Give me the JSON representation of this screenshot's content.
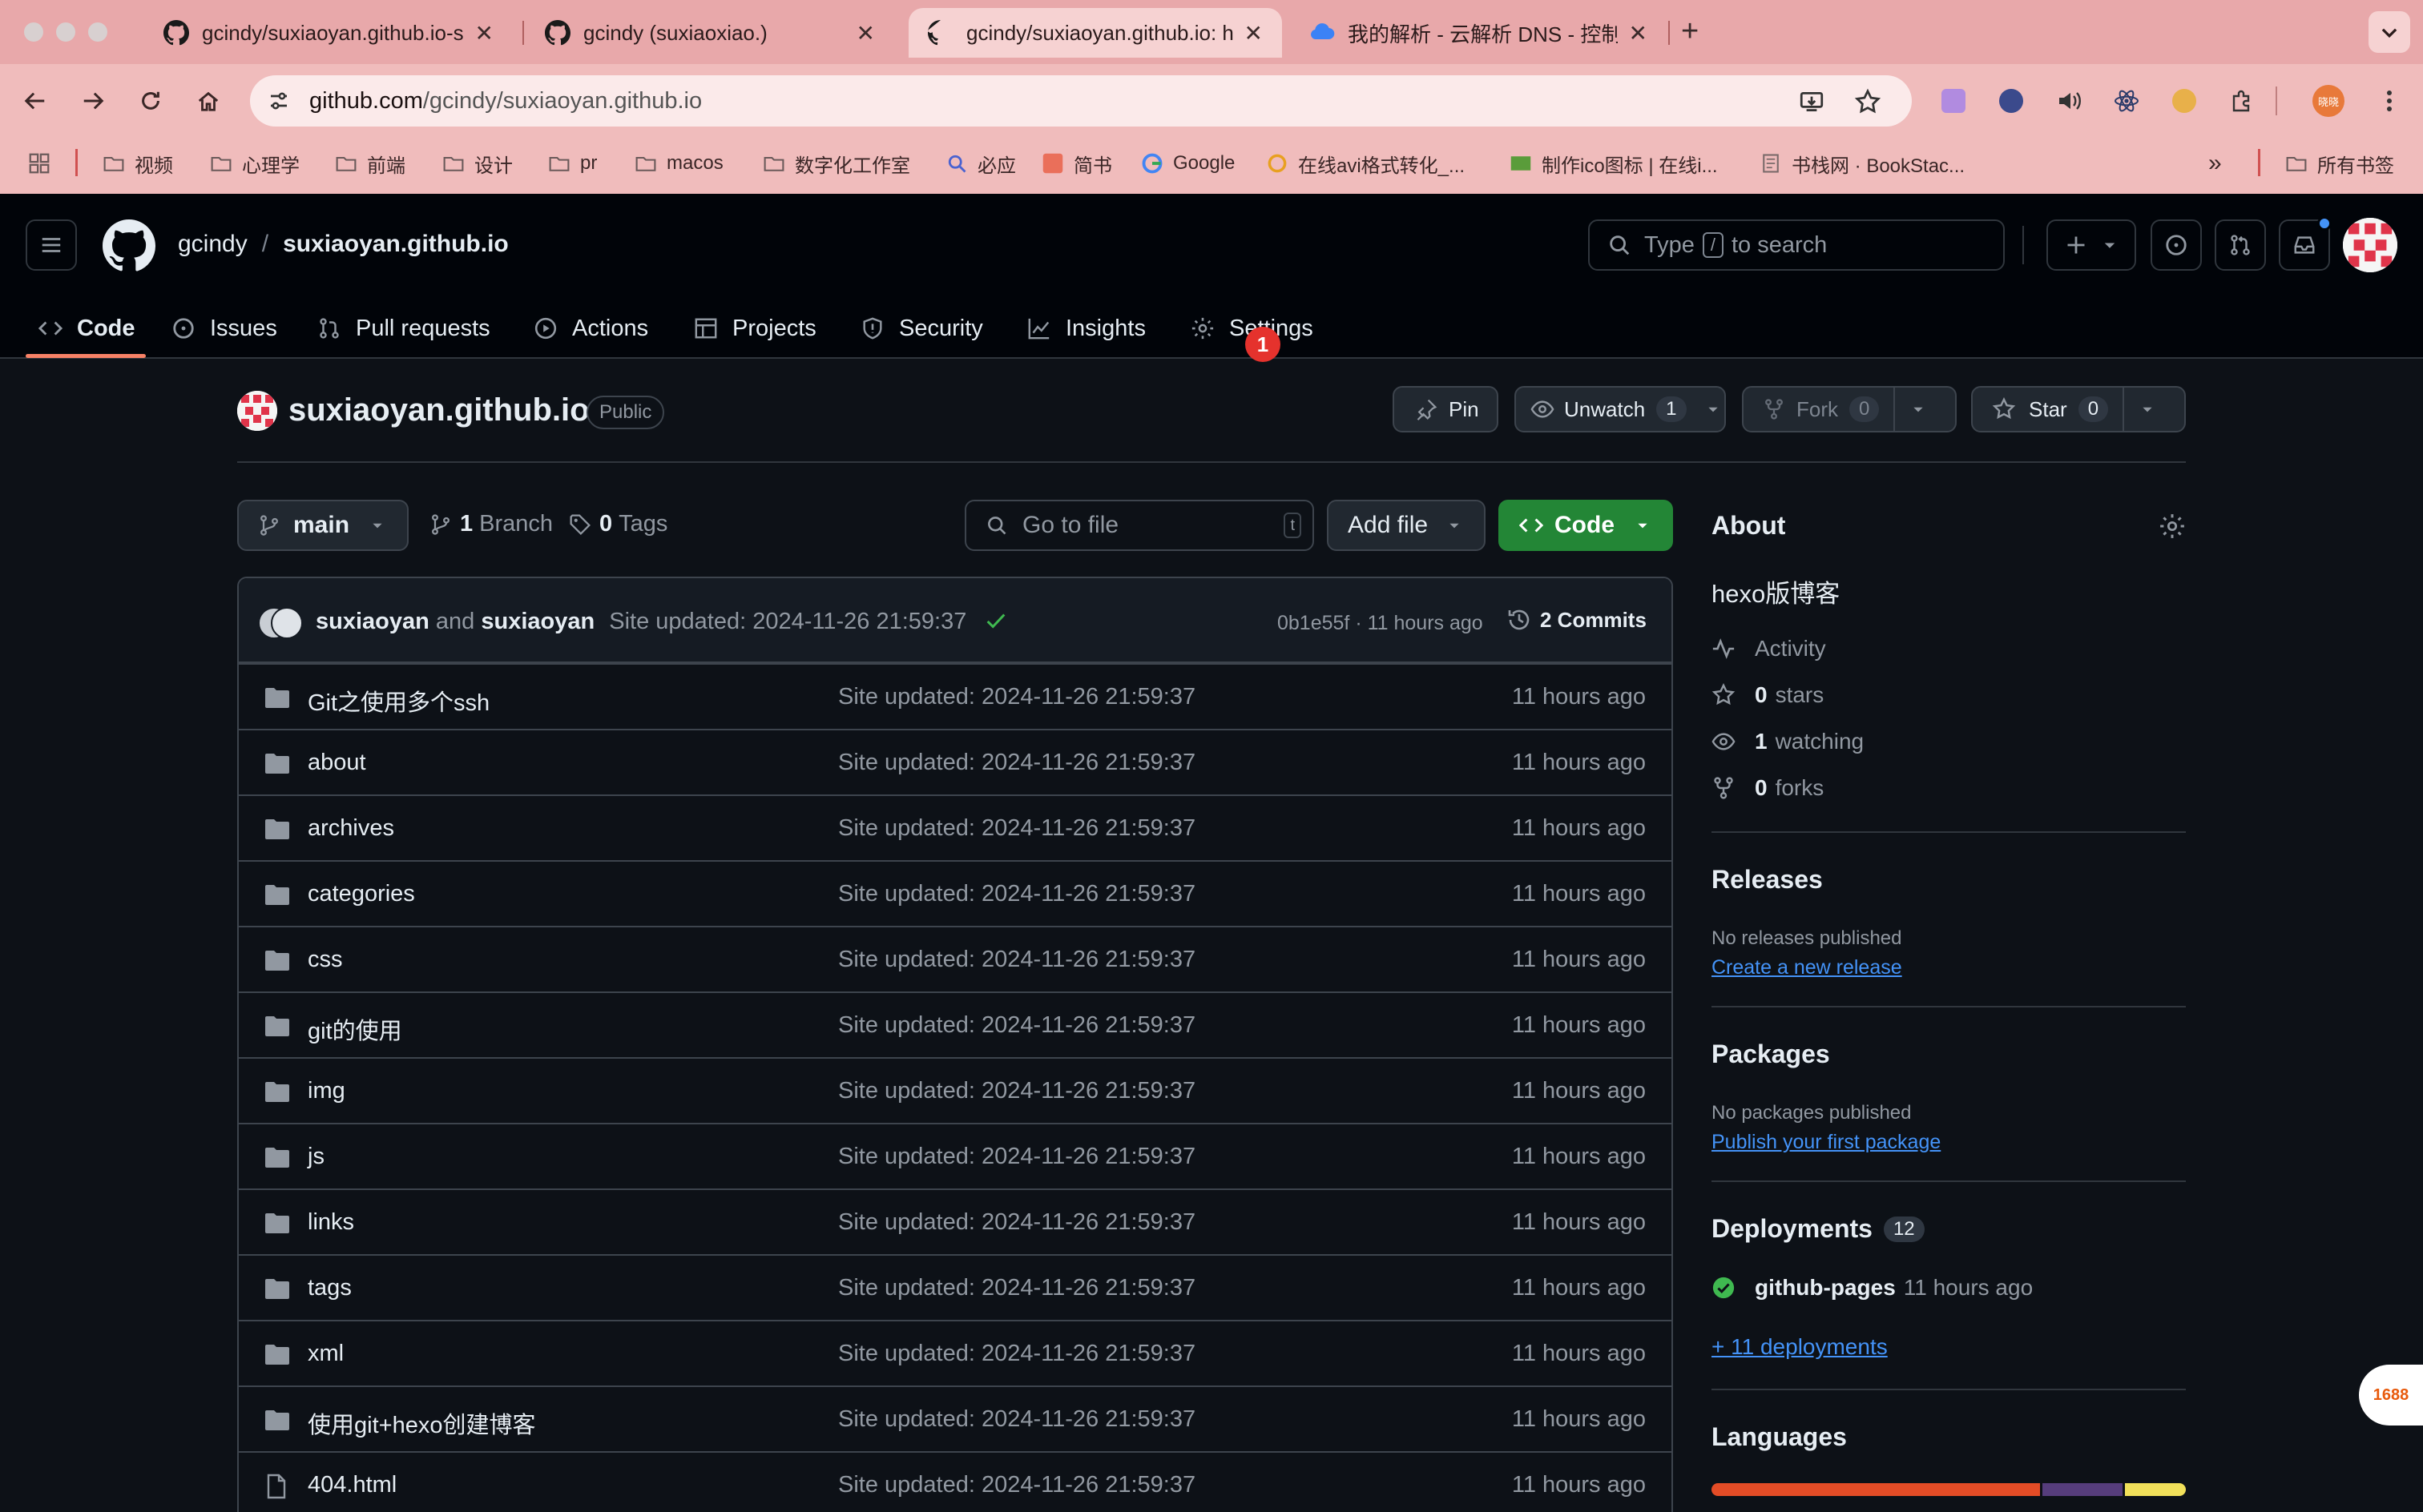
{
  "browser": {
    "tabs": [
      {
        "title": "gcindy/suxiaoyan.github.io-s"
      },
      {
        "title": "gcindy (suxiaoxiao.)"
      },
      {
        "title": "gcindy/suxiaoyan.github.io: h"
      },
      {
        "title": "我的解析 - 云解析 DNS - 控制台"
      }
    ],
    "url_host": "github.com",
    "url_path": "/gcindy/suxiaoyan.github.io",
    "bookmarks": [
      "视频",
      "心理学",
      "前端",
      "设计",
      "pr",
      "macos",
      "数字化工作室",
      "必应",
      "简书",
      "Google",
      "在线avi格式转化_...",
      "制作ico图标 | 在线i...",
      "书栈网 · BookStac..."
    ],
    "all_bookmarks": "所有书签",
    "profile_label": "晓晓"
  },
  "header": {
    "owner": "gcindy",
    "separator": "/",
    "repo": "suxiaoyan.github.io",
    "search": {
      "prefix": "Type",
      "key": "/",
      "suffix": "to search"
    }
  },
  "repo_nav": {
    "items": [
      {
        "label": "Code",
        "icon": "code-icon"
      },
      {
        "label": "Issues",
        "icon": "issue-icon"
      },
      {
        "label": "Pull requests",
        "icon": "pull-request-icon"
      },
      {
        "label": "Actions",
        "icon": "play-icon"
      },
      {
        "label": "Projects",
        "icon": "table-icon"
      },
      {
        "label": "Security",
        "icon": "shield-icon"
      },
      {
        "label": "Insights",
        "icon": "graph-icon"
      },
      {
        "label": "Settings",
        "icon": "gear-icon"
      }
    ],
    "settings_badge": "1"
  },
  "repo_header": {
    "name": "suxiaoyan.github.io",
    "visibility": "Public",
    "pin": "Pin",
    "unwatch": "Unwatch",
    "watch_count": "1",
    "fork": "Fork",
    "fork_count": "0",
    "star": "Star",
    "star_count": "0"
  },
  "file_nav": {
    "branch": "main",
    "branch_count": "1",
    "branch_label": "Branch",
    "tag_count": "0",
    "tag_label": "Tags",
    "goto_placeholder": "Go to file",
    "goto_key": "t",
    "add_file": "Add file",
    "code": "Code"
  },
  "commit": {
    "author1": "suxiaoyan",
    "and": "and",
    "author2": "suxiaoyan",
    "message": "Site updated: 2024-11-26 21:59:37",
    "hash_age": "0b1e55f · 11 hours ago",
    "commits": "2 Commits"
  },
  "files": [
    {
      "name": "Git之使用多个ssh",
      "type": "folder",
      "message": "Site updated: 2024-11-26 21:59:37",
      "age": "11 hours ago"
    },
    {
      "name": "about",
      "type": "folder",
      "message": "Site updated: 2024-11-26 21:59:37",
      "age": "11 hours ago"
    },
    {
      "name": "archives",
      "type": "folder",
      "message": "Site updated: 2024-11-26 21:59:37",
      "age": "11 hours ago"
    },
    {
      "name": "categories",
      "type": "folder",
      "message": "Site updated: 2024-11-26 21:59:37",
      "age": "11 hours ago"
    },
    {
      "name": "css",
      "type": "folder",
      "message": "Site updated: 2024-11-26 21:59:37",
      "age": "11 hours ago"
    },
    {
      "name": "git的使用",
      "type": "folder",
      "message": "Site updated: 2024-11-26 21:59:37",
      "age": "11 hours ago"
    },
    {
      "name": "img",
      "type": "folder",
      "message": "Site updated: 2024-11-26 21:59:37",
      "age": "11 hours ago"
    },
    {
      "name": "js",
      "type": "folder",
      "message": "Site updated: 2024-11-26 21:59:37",
      "age": "11 hours ago"
    },
    {
      "name": "links",
      "type": "folder",
      "message": "Site updated: 2024-11-26 21:59:37",
      "age": "11 hours ago"
    },
    {
      "name": "tags",
      "type": "folder",
      "message": "Site updated: 2024-11-26 21:59:37",
      "age": "11 hours ago"
    },
    {
      "name": "xml",
      "type": "folder",
      "message": "Site updated: 2024-11-26 21:59:37",
      "age": "11 hours ago"
    },
    {
      "name": "使用git+hexo创建博客",
      "type": "folder",
      "message": "Site updated: 2024-11-26 21:59:37",
      "age": "11 hours ago"
    },
    {
      "name": "404.html",
      "type": "file",
      "message": "Site updated: 2024-11-26 21:59:37",
      "age": "11 hours ago"
    }
  ],
  "about": {
    "title": "About",
    "description": "hexo版博客",
    "activity": "Activity",
    "stars_count": "0",
    "stars_label": "stars",
    "watching_count": "1",
    "watching_label": "watching",
    "forks_count": "0",
    "forks_label": "forks"
  },
  "releases": {
    "title": "Releases",
    "empty": "No releases published",
    "link": "Create a new release"
  },
  "packages": {
    "title": "Packages",
    "empty": "No packages published",
    "link": "Publish your first package"
  },
  "deployments": {
    "title": "Deployments",
    "count": "12",
    "env": "github-pages",
    "age": "11 hours ago",
    "more": "+ 11 deployments"
  },
  "languages": {
    "title": "Languages",
    "segments": [
      {
        "share": 0.7,
        "color": "#e34c26"
      },
      {
        "share": 0.17,
        "color": "#563d7c"
      },
      {
        "share": 0.13,
        "color": "#f1e05a"
      }
    ]
  },
  "floating_badge": "1688",
  "colors": {
    "accent": "#f78166",
    "link": "#4493f8",
    "primary_button": "#238636",
    "badge": "#e5322d"
  }
}
